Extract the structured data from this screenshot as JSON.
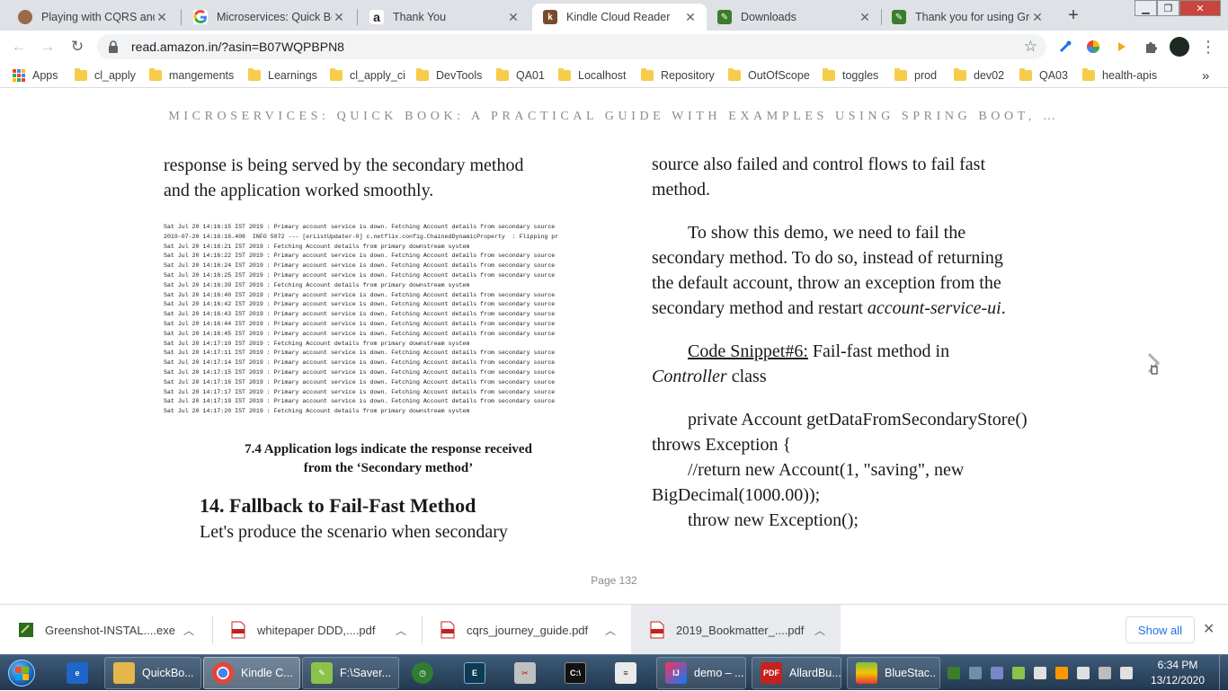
{
  "browser": {
    "tabs": [
      {
        "title": "Playing with CQRS and E",
        "icon": "github-avatar-icon",
        "color": "#9b6a4a"
      },
      {
        "title": "Microservices: Quick Boo",
        "icon": "google-icon",
        "color": "#4285f4"
      },
      {
        "title": "Thank You",
        "icon": "amazon-icon",
        "color": "#222222"
      },
      {
        "title": "Kindle Cloud Reader",
        "icon": "kindle-icon",
        "color": "#7a4b2b"
      },
      {
        "title": "Downloads",
        "icon": "greenshot-icon",
        "color": "#3b7d2a"
      },
      {
        "title": "Thank you for using Gree",
        "icon": "greenshot-icon",
        "color": "#3b7d2a"
      }
    ],
    "active_tab": 3,
    "url": "read.amazon.in/?asin=B07WQPBPN8",
    "bookmarks": {
      "apps_label": "Apps",
      "items": [
        "cl_apply",
        "mangements",
        "Learnings",
        "cl_apply_ci",
        "DevTools",
        "QA01",
        "Localhost",
        "Repository",
        "OutOfScope",
        "toggles",
        "prod",
        "dev02",
        "QA03",
        "health-apis"
      ],
      "overflow": "»"
    }
  },
  "reader": {
    "book_title": "MICROSERVICES: QUICK BOOK: A PRACTICAL GUIDE WITH EXAMPLES USING SPRING BOOT, …",
    "left": {
      "para1_line1": "response is being served by the secondary method",
      "para1_line2": "and the application worked smoothly.",
      "log_lines": [
        "Sat Jul 20 14:16:15 IST 2019 : Primary account service is down. Fetching Account details from secondary source",
        "2019-07-20 14:16:16.408  INFO 5072 --- [erListUpdater-0] c.netflix.config.ChainedDynamicProperty  : Flipping pr",
        "Sat Jul 20 14:16:21 IST 2019 : Fetching Account details from primary downstream system",
        "Sat Jul 20 14:16:22 IST 2019 : Primary account service is down. Fetching Account details from secondary source",
        "Sat Jul 20 14:16:24 IST 2019 : Primary account service is down. Fetching Account details from secondary source",
        "Sat Jul 20 14:16:25 IST 2019 : Primary account service is down. Fetching Account details from secondary source",
        "Sat Jul 20 14:16:39 IST 2019 : Fetching Account details from primary downstream system",
        "Sat Jul 20 14:16:40 IST 2019 : Primary account service is down. Fetching Account details from secondary source",
        "Sat Jul 20 14:16:42 IST 2019 : Primary account service is down. Fetching Account details from secondary source",
        "Sat Jul 20 14:16:43 IST 2019 : Primary account service is down. Fetching Account details from secondary source",
        "Sat Jul 20 14:16:44 IST 2019 : Primary account service is down. Fetching Account details from secondary source",
        "Sat Jul 20 14:16:45 IST 2019 : Primary account service is down. Fetching Account details from secondary source",
        "Sat Jul 20 14:17:10 IST 2019 : Fetching Account details from primary downstream system",
        "Sat Jul 20 14:17:11 IST 2019 : Primary account service is down. Fetching Account details from secondary source",
        "Sat Jul 20 14:17:14 IST 2019 : Primary account service is down. Fetching Account details from secondary source",
        "Sat Jul 20 14:17:15 IST 2019 : Primary account service is down. Fetching Account details from secondary source",
        "Sat Jul 20 14:17:16 IST 2019 : Primary account service is down. Fetching Account details from secondary source",
        "Sat Jul 20 14:17:17 IST 2019 : Primary account service is down. Fetching Account details from secondary source",
        "Sat Jul 20 14:17:19 IST 2019 : Primary account service is down. Fetching Account details from secondary source",
        "Sat Jul 20 14:17:20 IST 2019 : Fetching Account details from primary downstream system"
      ],
      "caption_line1": "7.4 Application logs indicate the response received",
      "caption_line2": "from the ‘Secondary method’",
      "heading": "14. Fallback to Fail-Fast Method",
      "para2": "Let's produce the scenario when secondary"
    },
    "right": {
      "l1": "source also failed and control flows to fail fast",
      "l2": "method.",
      "l3": "To show this demo, we need to fail the",
      "l4": "secondary method. To do so, instead of returning",
      "l5": "the default account, throw an exception from the",
      "l6_prefix": "secondary method and restart ",
      "l6_italic": "account-service-ui",
      "l6_suffix": ".",
      "l7_link": "Code Snippet#6:",
      "l7_rest": " Fail-fast method in",
      "l8_italic": "Controller",
      "l8_rest": " class",
      "code1": "private Account getDataFromSecondaryStore()",
      "code2": "throws Exception {",
      "code3": "//return new Account(1, \"saving\", new",
      "code4": "BigDecimal(1000.00));",
      "code5": "throw new Exception();"
    },
    "page_label": "Page 132"
  },
  "downloads": {
    "items": [
      {
        "name": "Greenshot-INSTAL....exe",
        "icon": "exe-installer-icon"
      },
      {
        "name": "whitepaper DDD,....pdf",
        "icon": "pdf-file-icon"
      },
      {
        "name": "cqrs_journey_guide.pdf",
        "icon": "pdf-file-icon"
      },
      {
        "name": "2019_Bookmatter_....pdf",
        "icon": "pdf-file-icon"
      }
    ],
    "show_all": "Show all"
  },
  "taskbar": {
    "items": [
      {
        "label": "",
        "icon": "ie-icon"
      },
      {
        "label": "QuickBo...",
        "icon": "folder-icon"
      },
      {
        "label": "Kindle C...",
        "icon": "chrome-icon"
      },
      {
        "label": "F:\\Saver...",
        "icon": "notepadpp-icon"
      },
      {
        "label": "",
        "icon": "timer-icon"
      },
      {
        "label": "",
        "icon": "editor-icon"
      },
      {
        "label": "",
        "icon": "snipping-icon"
      },
      {
        "label": "",
        "icon": "cmd-icon"
      },
      {
        "label": "",
        "icon": "notepad-icon"
      },
      {
        "label": "demo – ...",
        "icon": "intellij-icon"
      },
      {
        "label": "AllardBu...",
        "icon": "pdf-reader-icon"
      },
      {
        "label": "BlueStac...",
        "icon": "bluestacks-icon"
      }
    ],
    "time": "6:34 PM",
    "date": "13/12/2020"
  }
}
